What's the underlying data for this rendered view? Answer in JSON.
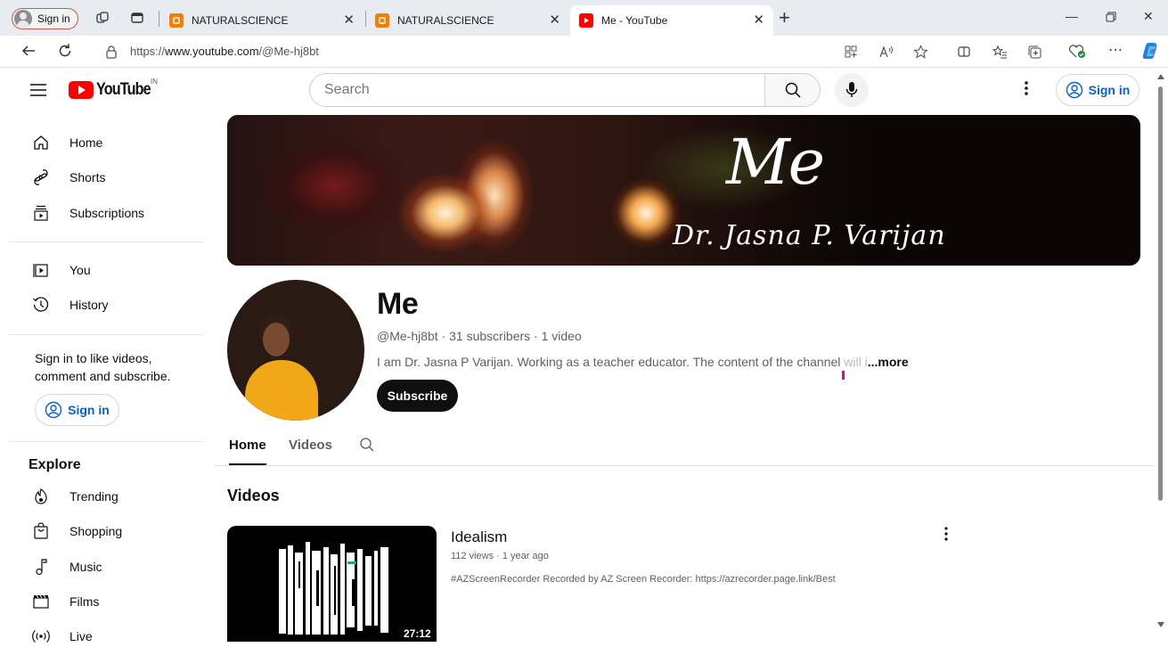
{
  "browser": {
    "profile_label": "Sign in",
    "tabs": [
      {
        "title": "NATURALSCIENCE",
        "favicon": "blogger-icon"
      },
      {
        "title": "NATURALSCIENCE",
        "favicon": "blogger-icon"
      },
      {
        "title": "Me - YouTube",
        "favicon": "youtube-icon",
        "active": true
      }
    ],
    "url_prefix": "https://",
    "url_host": "www.youtube.com",
    "url_path": "/@Me-hj8bt"
  },
  "youtube": {
    "logo_text": "YouTube",
    "country_code": "IN",
    "search_placeholder": "Search",
    "signin_label": "Sign in"
  },
  "sidebar": {
    "main": [
      {
        "label": "Home",
        "icon": "home-icon"
      },
      {
        "label": "Shorts",
        "icon": "shorts-icon"
      },
      {
        "label": "Subscriptions",
        "icon": "subscriptions-icon"
      }
    ],
    "you": [
      {
        "label": "You",
        "icon": "you-icon"
      },
      {
        "label": "History",
        "icon": "history-icon"
      }
    ],
    "signin_prompt": "Sign in to like videos, comment and subscribe.",
    "signin_label": "Sign in",
    "explore_title": "Explore",
    "explore": [
      {
        "label": "Trending",
        "icon": "trending-icon"
      },
      {
        "label": "Shopping",
        "icon": "shopping-icon"
      },
      {
        "label": "Music",
        "icon": "music-icon"
      },
      {
        "label": "Films",
        "icon": "films-icon"
      },
      {
        "label": "Live",
        "icon": "live-icon"
      }
    ]
  },
  "banner": {
    "title": "Me",
    "subtitle": "Dr. Jasna P. Varijan"
  },
  "channel": {
    "name": "Me",
    "meta": "@Me-hj8bt · 31 subscribers · 1 video",
    "description": "I am Dr. Jasna P Varijan. Working as a teacher educator.  The content of the channel",
    "description_fade": " will i",
    "more_label": "...more",
    "subscribe_label": "Subscribe",
    "tabs": [
      "Home",
      "Videos"
    ],
    "active_tab": "Home"
  },
  "videos": {
    "section_title": "Videos",
    "items": [
      {
        "title": "Idealism",
        "meta": "112 views · 1 year ago",
        "description": "#AZScreenRecorder Recorded by AZ Screen Recorder: https://azrecorder.page.link/Best",
        "duration": "27:12"
      }
    ]
  }
}
